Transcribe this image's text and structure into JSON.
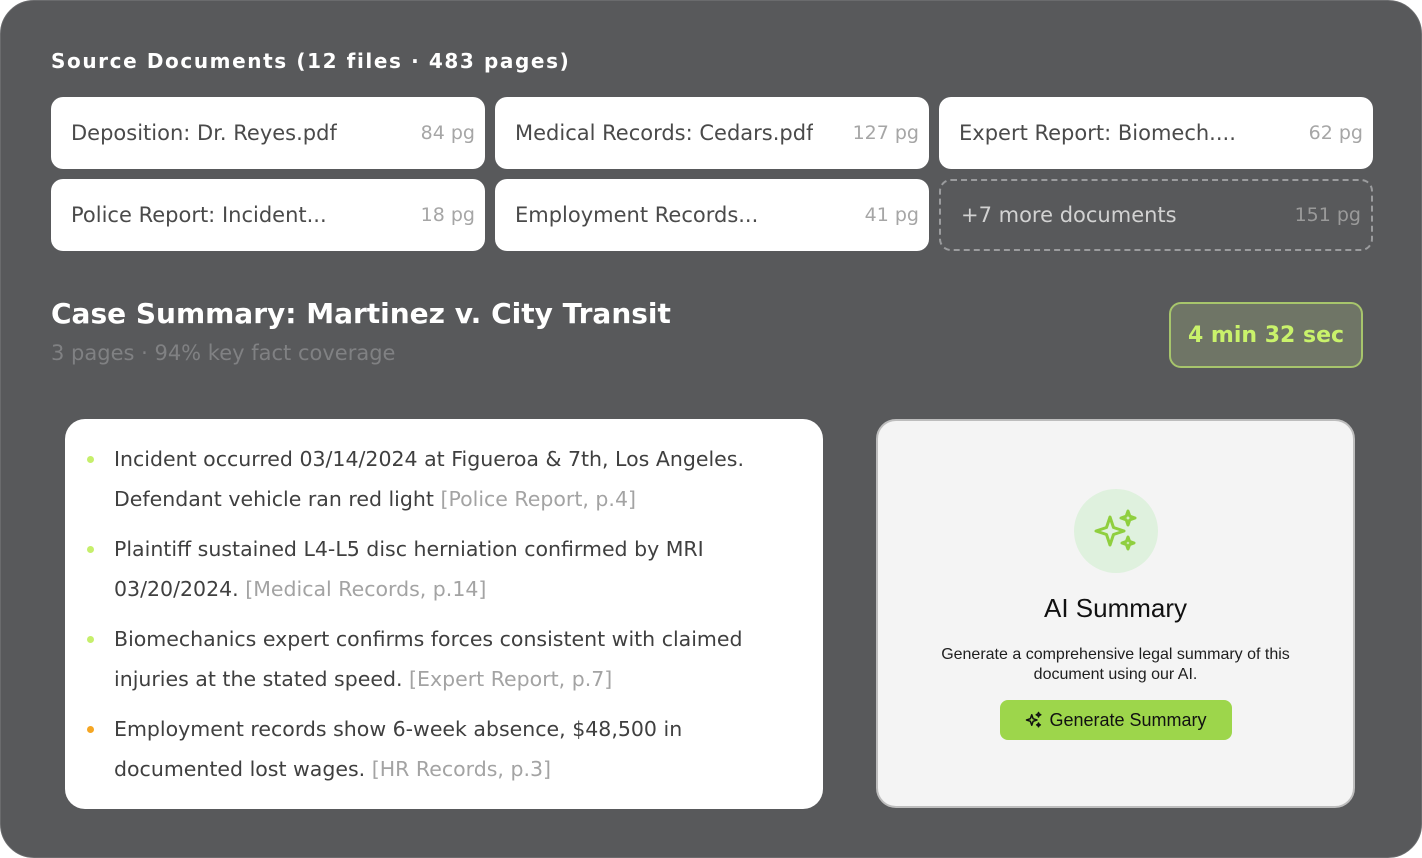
{
  "source_documents": {
    "title": "Source Documents (12 files · 483 pages)",
    "files": [
      {
        "name": "Deposition: Dr. Reyes.pdf",
        "pages": "84 pg"
      },
      {
        "name": "Medical Records: Cedars.pdf",
        "pages": "127 pg"
      },
      {
        "name": "Expert Report: Biomech....",
        "pages": "62 pg"
      },
      {
        "name": "Police Report: Incident...",
        "pages": "18 pg"
      },
      {
        "name": "Employment Records...",
        "pages": "41 pg"
      }
    ],
    "more": {
      "name": "+7 more documents",
      "pages": "151 pg"
    }
  },
  "case": {
    "title": "Case Summary: Martinez v. City Transit",
    "subtitle": "3 pages · 94% key fact coverage",
    "timer": "4 min 32 sec"
  },
  "facts": [
    {
      "text": "Incident occurred 03/14/2024 at Figueroa & 7th, Los Angeles. Defendant vehicle ran red light",
      "cite": "[Police Report, p.4]",
      "bullet_color": "#c6ef6b"
    },
    {
      "text": "Plaintiff sustained L4-L5 disc herniation confirmed by MRI 03/20/2024.",
      "cite": "[Medical Records, p.14]",
      "bullet_color": "#c6ef6b"
    },
    {
      "text": "Biomechanics expert confirms forces consistent with claimed injuries at the stated speed.",
      "cite": "[Expert Report, p.7]",
      "bullet_color": "#c6ef6b"
    },
    {
      "text": "Employment records show 6-week absence, $48,500 in documented lost wages.",
      "cite": "[HR Records, p.3]",
      "bullet_color": "#f5a623"
    }
  ],
  "ai_summary": {
    "icon": "sparkles-icon",
    "title": "AI Summary",
    "description": "Generate a comprehensive legal summary of this document using our AI.",
    "button_label": "Generate Summary"
  },
  "colors": {
    "background": "#58595b",
    "accent_green": "#9dd64b",
    "timer_text": "#c9f26b"
  }
}
